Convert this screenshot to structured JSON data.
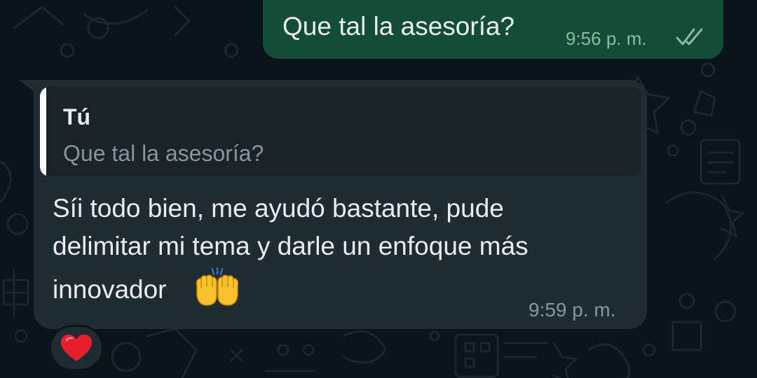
{
  "outgoing_message": {
    "text": "Que tal la asesoría?",
    "time": "9:56 p. m.",
    "status_icon": "double-check-icon",
    "colors": {
      "bubble": "#144d37",
      "text": "#e9edef",
      "meta": "#8fb8a5"
    }
  },
  "incoming_message": {
    "quote": {
      "author": "Tú",
      "text": "Que tal la asesoría?"
    },
    "lines": [
      "Síi todo bien, me ayudó bastante, pude",
      "delimitar mi tema y darle un enfoque más",
      "innovador"
    ],
    "emoji_icon": "raising-hands-icon",
    "time": "9:59 p. m.",
    "reaction_icon": "red-heart-icon",
    "colors": {
      "bubble": "#202c33",
      "quote_bg": "#1a2328",
      "text": "#e9edef",
      "meta": "#8696a0"
    }
  },
  "theme": {
    "background": "#0b141a",
    "doodle": "#1c262c"
  }
}
